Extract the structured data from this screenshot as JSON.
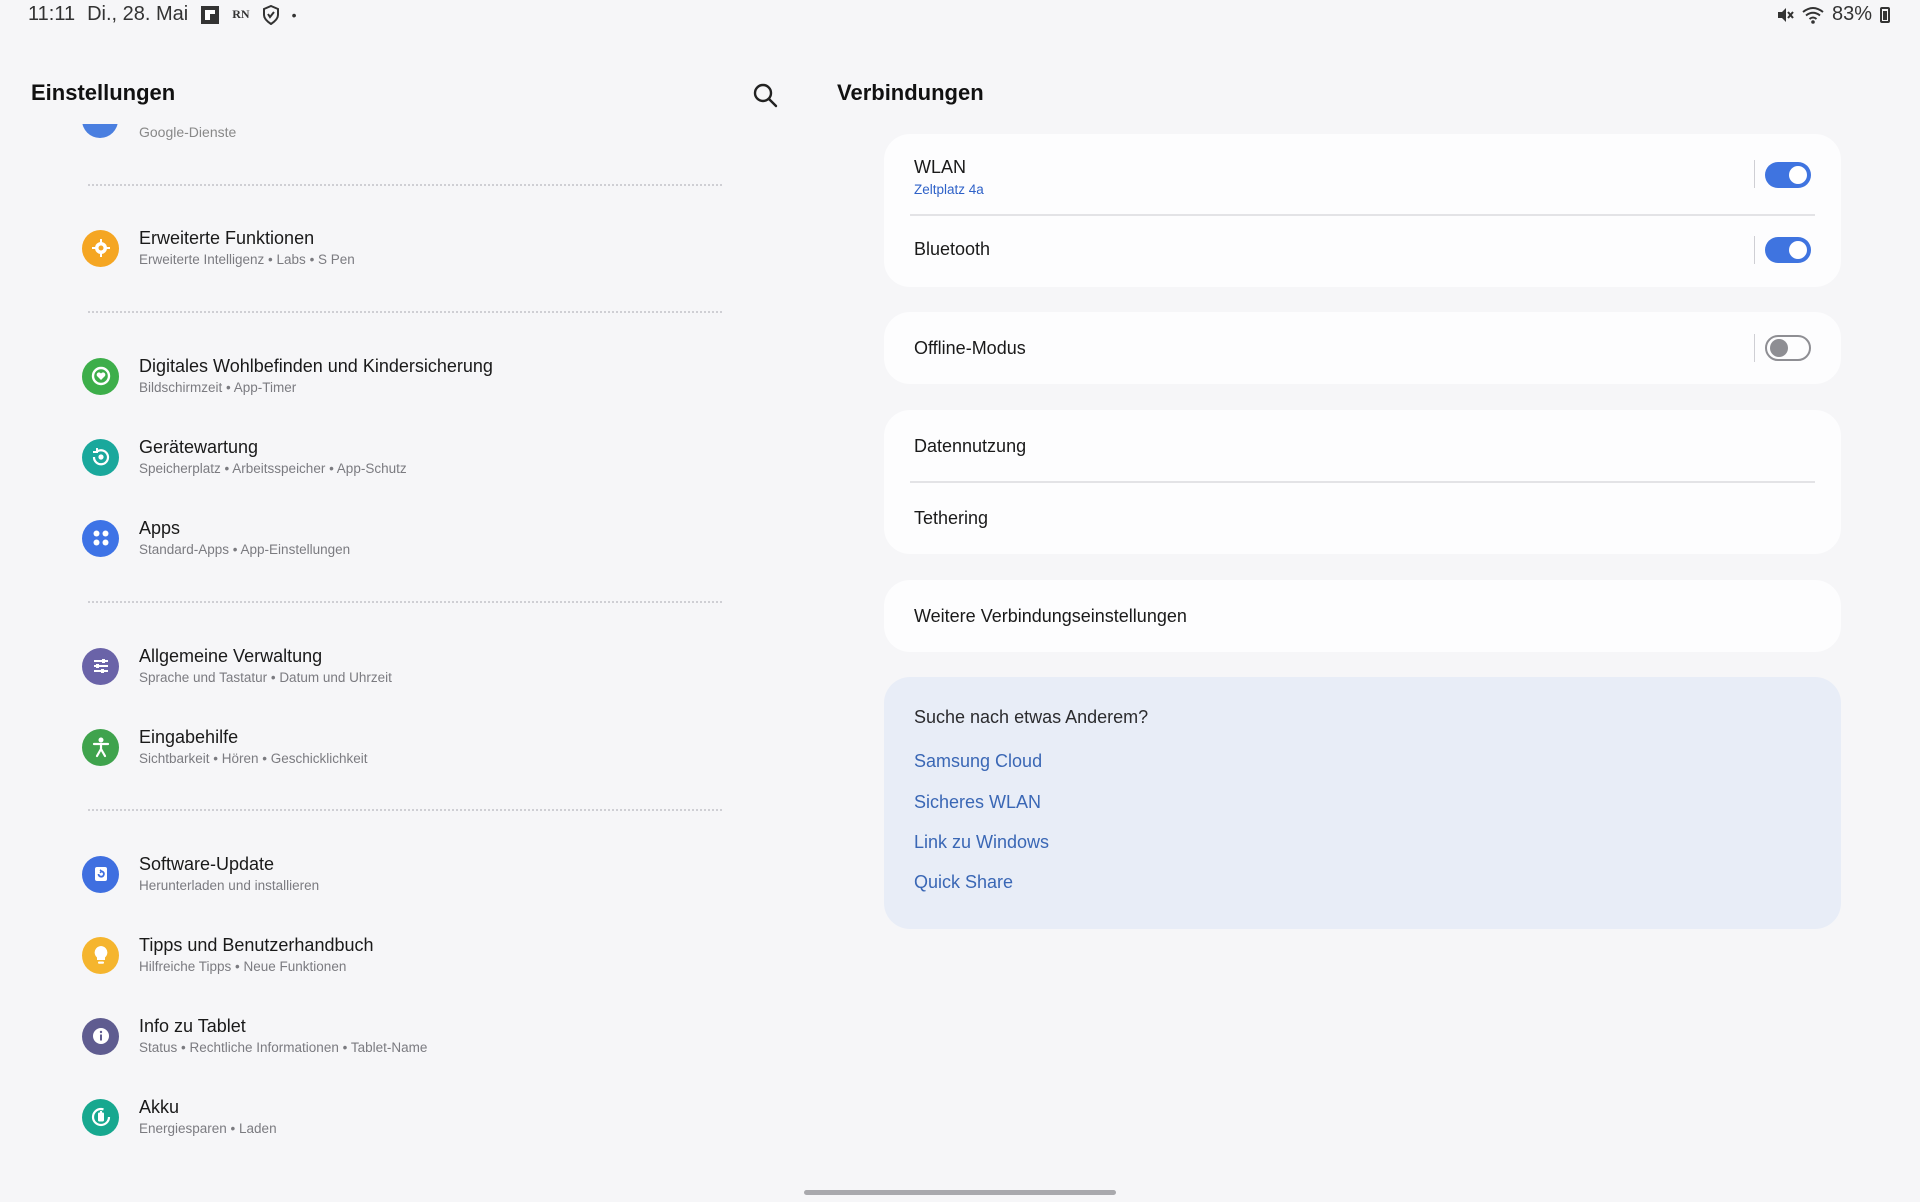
{
  "status_bar": {
    "time": "11:11",
    "date": "Di., 28. Mai",
    "notif_icons": [
      "flipboard-icon",
      "rn-icon",
      "shield-icon"
    ],
    "rn_label": "RN",
    "dot": "•",
    "battery": "83%"
  },
  "left_pane": {
    "title": "Einstellungen",
    "cut_item_sub": "Google-Dienste",
    "items": [
      {
        "title": "Erweiterte Funktionen",
        "sub": "Erweiterte Intelligenz  •  Labs  •  S Pen",
        "color": "#f5a623"
      },
      {
        "title": "Digitales Wohlbefinden und Kindersicherung",
        "sub": "Bildschirmzeit  •  App-Timer",
        "color": "#3dae4a"
      },
      {
        "title": "Gerätewartung",
        "sub": "Speicherplatz  •  Arbeitsspeicher  •  App-Schutz",
        "color": "#1aa89c"
      },
      {
        "title": "Apps",
        "sub": "Standard-Apps  •  App-Einstellungen",
        "color": "#3e73e6"
      },
      {
        "title": "Allgemeine Verwaltung",
        "sub": "Sprache und Tastatur  •  Datum und Uhrzeit",
        "color": "#6a63a8"
      },
      {
        "title": "Eingabehilfe",
        "sub": "Sichtbarkeit  •  Hören  •  Geschicklichkeit",
        "color": "#3fa34d"
      },
      {
        "title": "Software-Update",
        "sub": "Herunterladen und installieren",
        "color": "#3f6fe0"
      },
      {
        "title": "Tipps und Benutzerhandbuch",
        "sub": "Hilfreiche Tipps  •  Neue Funktionen",
        "color": "#f5b52e"
      },
      {
        "title": "Info zu Tablet",
        "sub": "Status  •  Rechtliche Informationen  •  Tablet-Name",
        "color": "#5f5c90"
      },
      {
        "title": "Akku",
        "sub": "Energiesparen  •  Laden",
        "color": "#17a88f"
      }
    ]
  },
  "right_pane": {
    "title": "Verbindungen",
    "wlan": {
      "title": "WLAN",
      "sub": "Zeltplatz 4a",
      "enabled": true
    },
    "bluetooth": {
      "title": "Bluetooth",
      "enabled": true
    },
    "offline": {
      "title": "Offline-Modus",
      "enabled": false
    },
    "data_usage": "Datennutzung",
    "tethering": "Tethering",
    "more": "Weitere Verbindungseinstellungen",
    "suggest": {
      "title": "Suche nach etwas Anderem?",
      "links": [
        "Samsung Cloud",
        "Sicheres WLAN",
        "Link zu Windows",
        "Quick Share"
      ]
    }
  },
  "colors": {
    "accent": "#3f74e0",
    "link": "#3a67b5",
    "background": "#f6f6f8"
  }
}
